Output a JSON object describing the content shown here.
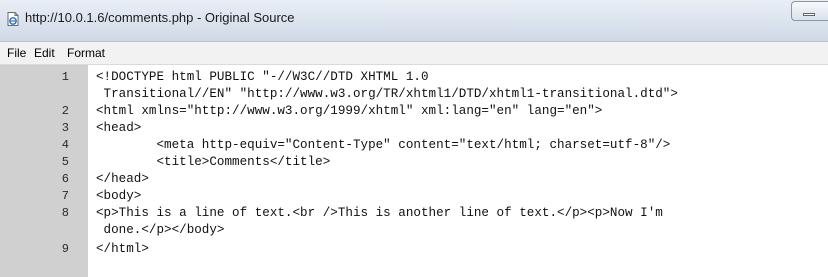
{
  "window": {
    "title": "http://10.0.1.6/comments.php - Original Source",
    "app_icon": "internet-explorer-page-icon",
    "minimize_icon": "minimize-icon"
  },
  "menu": {
    "items": [
      "File",
      "Edit",
      "Format"
    ]
  },
  "source": {
    "lines": [
      {
        "num": "1",
        "text": "<!DOCTYPE html PUBLIC \"-//W3C//DTD XHTML 1.0"
      },
      {
        "num": "",
        "text": " Transitional//EN\" \"http://www.w3.org/TR/xhtml1/DTD/xhtml1-transitional.dtd\">"
      },
      {
        "num": "2",
        "text": "<html xmlns=\"http://www.w3.org/1999/xhtml\" xml:lang=\"en\" lang=\"en\">"
      },
      {
        "num": "3",
        "text": "<head>"
      },
      {
        "num": "4",
        "text": "        <meta http-equiv=\"Content-Type\" content=\"text/html; charset=utf-8\"/>"
      },
      {
        "num": "5",
        "text": "        <title>Comments</title>"
      },
      {
        "num": "6",
        "text": "</head>"
      },
      {
        "num": "7",
        "text": "<body>"
      },
      {
        "num": "8",
        "text": "<p>This is a line of text.<br />This is another line of text.</p><p>Now I'm"
      },
      {
        "num": "",
        "text": " done.</p></body>"
      },
      {
        "num": "9",
        "text": "</html>"
      }
    ]
  },
  "colors": {
    "gutter": "#d0d0d0",
    "titlebar": "#dde5ef",
    "menubar": "#f2f2f2"
  }
}
